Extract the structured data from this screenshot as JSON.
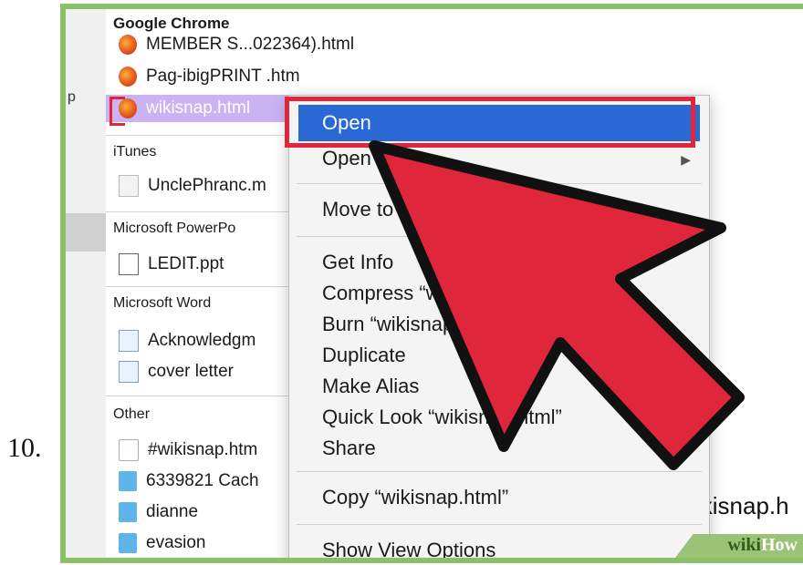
{
  "step": {
    "number": "10."
  },
  "sidebar": {
    "char": "p"
  },
  "finder_list": {
    "groups": [
      {
        "header": "Google Chrome",
        "items": [
          {
            "label": "MEMBER S...022364).html",
            "icon": "firefox-icon"
          },
          {
            "label": "Pag-ibigPRINT .htm",
            "icon": "firefox-icon"
          },
          {
            "label": "wikisnap.html",
            "icon": "firefox-icon",
            "selected": true
          }
        ]
      },
      {
        "header": "iTunes",
        "items": [
          {
            "label": "UnclePhranc.m",
            "icon": "music-file-icon"
          }
        ]
      },
      {
        "header": "Microsoft PowerPo",
        "items": [
          {
            "label": "LEDIT.ppt",
            "icon": "ppt-icon"
          }
        ]
      },
      {
        "header": "Microsoft Word",
        "items": [
          {
            "label": "Acknowledgm",
            "icon": "word-doc-icon"
          },
          {
            "label": "cover letter",
            "icon": "word-doc-icon"
          }
        ]
      },
      {
        "header": "Other",
        "items": [
          {
            "label": "#wikisnap.htm",
            "icon": "document-icon"
          },
          {
            "label": "6339821 Cach",
            "icon": "folder-icon"
          },
          {
            "label": "dianne",
            "icon": "folder-icon"
          },
          {
            "label": "evasion",
            "icon": "folder-icon"
          }
        ]
      }
    ]
  },
  "context_menu": {
    "open": "Open",
    "open_with": "Open With",
    "move_to": "Move to",
    "get_info": "Get Info",
    "compress": "Compress “wikisnap.html”",
    "burn": "Burn “wikisnap.html” to Disc...",
    "duplicate": "Duplicate",
    "make_alias": "Make Alias",
    "quick_look": "Quick Look “wikisnap.html”",
    "share": "Share",
    "copy": "Copy “wikisnap.html”",
    "show_view_options": "Show View Options"
  },
  "background_label": "ikisnap.h",
  "watermark": {
    "part1": "wiki",
    "part2": "How"
  },
  "colors": {
    "frame_green": "#8cbf6a",
    "highlight_blue": "#2a69d4",
    "annotation_red": "#e0263a",
    "selection_purple": "#c9b3f2"
  }
}
